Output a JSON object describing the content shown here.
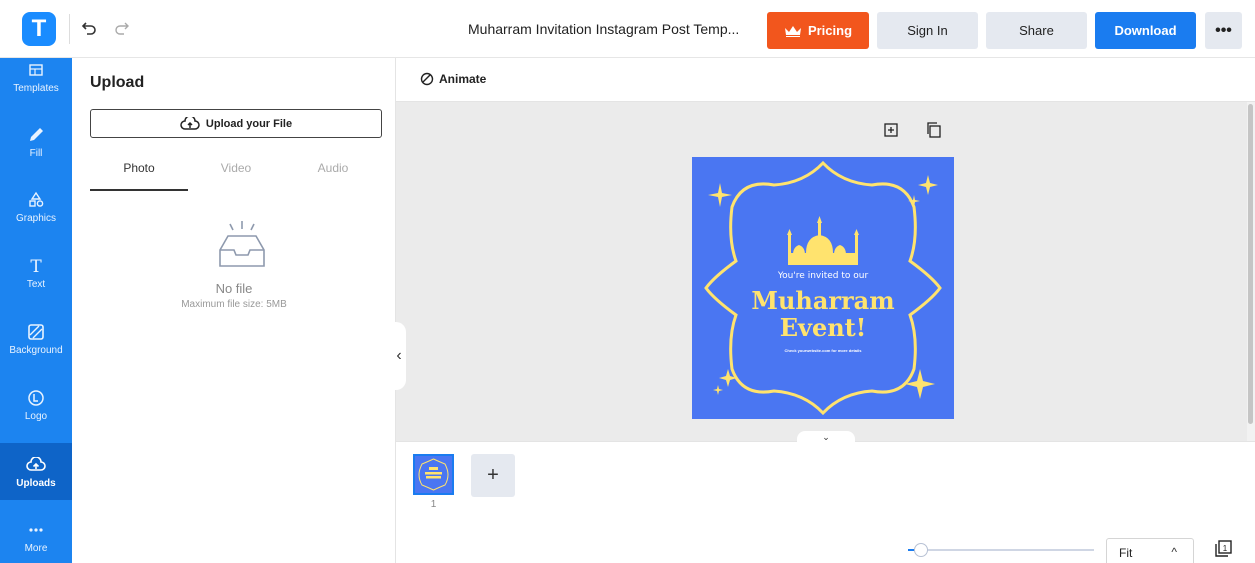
{
  "app": {
    "logo_letter": "T"
  },
  "header": {
    "document_title": "Muharram Invitation Instagram Post Temp...",
    "pricing_label": "Pricing",
    "signin_label": "Sign In",
    "share_label": "Share",
    "download_label": "Download",
    "more_label": "•••"
  },
  "sidebar": {
    "items": [
      {
        "label": "Templates",
        "icon": "templates-icon"
      },
      {
        "label": "Fill",
        "icon": "pencil-icon"
      },
      {
        "label": "Graphics",
        "icon": "shapes-icon"
      },
      {
        "label": "Text",
        "icon": "text-icon"
      },
      {
        "label": "Background",
        "icon": "background-icon"
      },
      {
        "label": "Logo",
        "icon": "logo-icon"
      },
      {
        "label": "Uploads",
        "icon": "cloud-upload-icon",
        "active": true
      },
      {
        "label": "More",
        "icon": "more-dots-icon"
      }
    ]
  },
  "panel": {
    "title": "Upload",
    "upload_button": "Upload your File",
    "tabs": [
      {
        "label": "Photo",
        "active": true
      },
      {
        "label": "Video"
      },
      {
        "label": "Audio"
      }
    ],
    "empty_title": "No file",
    "empty_subtitle": "Maximum file size: 5MB"
  },
  "canvas": {
    "animate_label": "Animate",
    "collapse_glyph": "‹",
    "design": {
      "invite_text": "You're invited to our",
      "headline_1": "Muharram",
      "headline_2": "Event!",
      "small_text": "Check yourwebsite.com for more details"
    },
    "page_number": "1",
    "add_page_glyph": "+",
    "expand_glyph": "⌄"
  },
  "zoom": {
    "level_label": "Fit",
    "chevron": "^",
    "slider_value": 0.03
  },
  "colors": {
    "brand_blue": "#1c84f0",
    "pricing_orange": "#f2561d",
    "download_blue": "#1a7cf0",
    "design_bg": "#4a76f2",
    "design_gold": "#ffe36e"
  }
}
